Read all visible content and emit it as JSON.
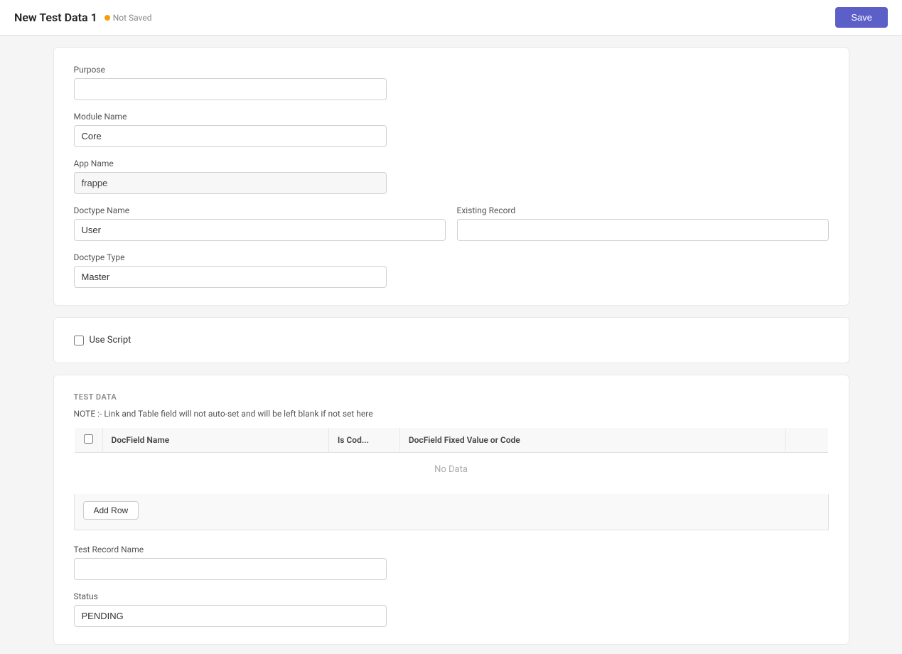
{
  "topbar": {
    "title": "New Test Data 1",
    "not_saved_label": "Not Saved",
    "save_button_label": "Save"
  },
  "form": {
    "purpose_label": "Purpose",
    "purpose_value": "",
    "purpose_placeholder": "",
    "module_name_label": "Module Name",
    "module_name_value": "Core",
    "app_name_label": "App Name",
    "app_name_value": "frappe",
    "doctype_name_label": "Doctype Name",
    "doctype_name_value": "User",
    "existing_record_label": "Existing Record",
    "existing_record_value": "",
    "doctype_type_label": "Doctype Type",
    "doctype_type_value": "Master"
  },
  "script_section": {
    "use_script_label": "Use Script",
    "checked": false
  },
  "test_data_section": {
    "section_label": "TEST DATA",
    "note": "NOTE :- Link and Table field will not auto-set and will be left blank if not set here",
    "table": {
      "col_checkbox": "",
      "col_docfield_name": "DocField Name",
      "col_is_code": "Is Cod...",
      "col_fixed_value": "DocField Fixed Value or Code",
      "col_actions": "",
      "no_data_text": "No Data",
      "rows": []
    },
    "add_row_button_label": "Add Row",
    "test_record_name_label": "Test Record Name",
    "test_record_name_value": "",
    "status_label": "Status",
    "status_value": "PENDING"
  }
}
